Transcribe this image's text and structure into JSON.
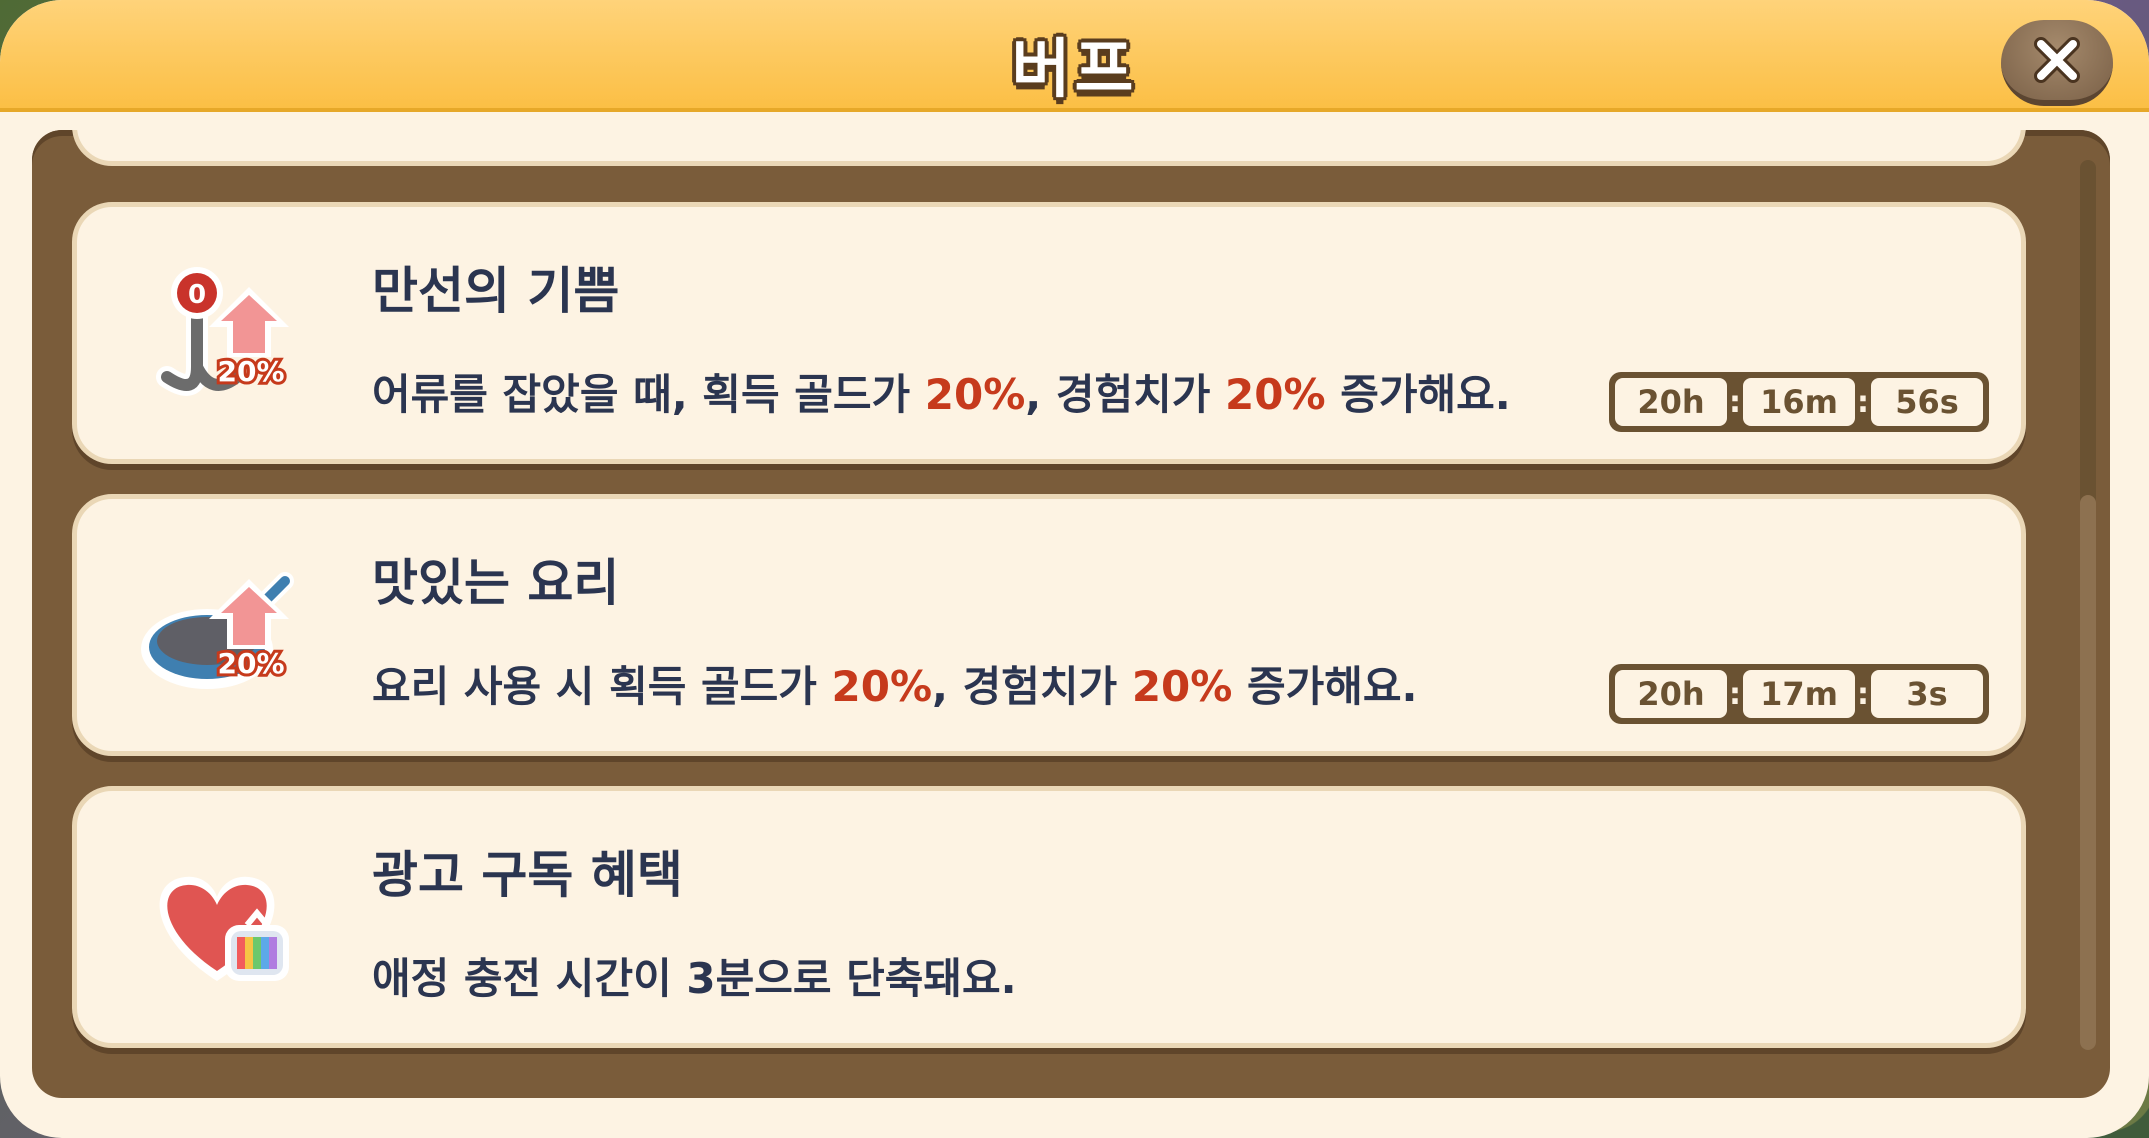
{
  "header": {
    "title": "버프",
    "close_icon": "close-x-icon"
  },
  "buffs": [
    {
      "name": "만선의 기쁨",
      "icon": "hook-boost-icon",
      "icon_badge": "20%",
      "icon_digit": "0",
      "desc_parts": [
        "어류를 잡았을 때, 획득 골드가 ",
        "20%",
        ", 경험치가 ",
        "20%",
        " 증가해요."
      ],
      "timer": {
        "h": "20h",
        "m": "16m",
        "s": "56s"
      }
    },
    {
      "name": "맛있는 요리",
      "icon": "frying-pan-boost-icon",
      "icon_badge": "20%",
      "desc_parts": [
        "요리 사용 시 획득 골드가 ",
        "20%",
        ", 경험치가 ",
        "20%",
        " 증가해요."
      ],
      "timer": {
        "h": "20h",
        "m": "17m",
        "s": "3s"
      }
    },
    {
      "name": "광고 구독 혜택",
      "icon": "heart-tv-icon",
      "desc_parts": [
        "애정 충전 시간이 3분으로 단축돼요."
      ]
    }
  ],
  "colors": {
    "highlight": "#c63a1c",
    "text": "#2b3550",
    "header": "#fbbf45",
    "frame": "#7a5c3a"
  }
}
